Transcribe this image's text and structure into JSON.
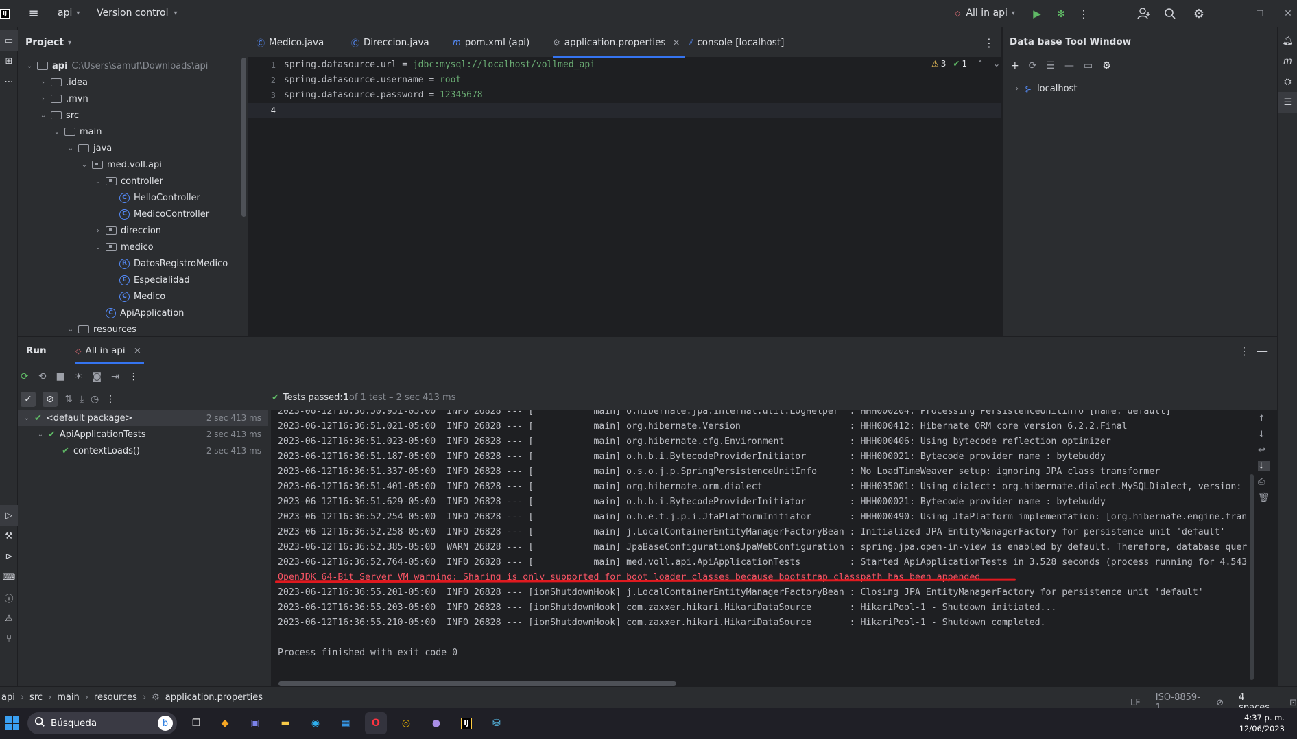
{
  "titlebar": {
    "project_name": "api",
    "vcs": "Version control",
    "run_config": "All in api"
  },
  "project_panel": {
    "title": "Project",
    "tree": [
      {
        "label": "api",
        "path": "C:\\Users\\samuf\\Downloads\\api",
        "kind": "folder",
        "level": 0,
        "expanded": true
      },
      {
        "label": ".idea",
        "kind": "folder",
        "level": 1,
        "expanded": false
      },
      {
        "label": ".mvn",
        "kind": "folder",
        "level": 1,
        "expanded": false
      },
      {
        "label": "src",
        "kind": "folder",
        "level": 1,
        "expanded": true
      },
      {
        "label": "main",
        "kind": "folder",
        "level": 2,
        "expanded": true
      },
      {
        "label": "java",
        "kind": "folder",
        "level": 3,
        "expanded": true
      },
      {
        "label": "med.voll.api",
        "kind": "package",
        "level": 4,
        "expanded": true
      },
      {
        "label": "controller",
        "kind": "package",
        "level": 5,
        "expanded": true
      },
      {
        "label": "HelloController",
        "kind": "class",
        "badge": "C",
        "level": 6
      },
      {
        "label": "MedicoController",
        "kind": "class",
        "badge": "C",
        "level": 6
      },
      {
        "label": "direccion",
        "kind": "package",
        "level": 5,
        "expanded": false
      },
      {
        "label": "medico",
        "kind": "package",
        "level": 5,
        "expanded": true
      },
      {
        "label": "DatosRegistroMedico",
        "kind": "class",
        "badge": "R",
        "level": 6
      },
      {
        "label": "Especialidad",
        "kind": "class",
        "badge": "E",
        "level": 6
      },
      {
        "label": "Medico",
        "kind": "class",
        "badge": "C",
        "level": 6
      },
      {
        "label": "ApiApplication",
        "kind": "class",
        "badge": "C",
        "level": 5
      },
      {
        "label": "resources",
        "kind": "folder",
        "level": 3,
        "expanded": true
      }
    ]
  },
  "editor": {
    "tabs": [
      {
        "label": "Medico.java",
        "icon": "C",
        "active": false
      },
      {
        "label": "Direccion.java",
        "icon": "C",
        "active": false
      },
      {
        "label": "pom.xml (api)",
        "icon": "m",
        "active": false
      },
      {
        "label": "application.properties",
        "icon": "gear",
        "active": true
      },
      {
        "label": "console [localhost]",
        "icon": "db",
        "active": false
      }
    ],
    "close_glyph": "×",
    "lines": [
      {
        "n": "1",
        "key": "spring.datasource.url",
        "eq": " = ",
        "value": "jdbc:mysql://localhost/vollmed_api"
      },
      {
        "n": "2",
        "key": "spring.datasource.username",
        "eq": " = ",
        "value": "root"
      },
      {
        "n": "3",
        "key": "spring.datasource.password",
        "eq": " = ",
        "value": "12345678"
      },
      {
        "n": "4",
        "key": "",
        "eq": "",
        "value": ""
      }
    ],
    "inspections": {
      "warnings": "3",
      "ok": "1"
    }
  },
  "db_panel": {
    "title": "Data base Tool Window",
    "tree": [
      {
        "label": "localhost"
      }
    ]
  },
  "run_panel": {
    "tab_run": "Run",
    "tab_config": "All in api",
    "tests_status_prefix": "Tests passed: ",
    "tests_passed": "1",
    "tests_status_suffix": " of 1 test – 2 sec 413 ms",
    "test_tree": [
      {
        "label": "<default package>",
        "time": "2 sec 413 ms",
        "level": 0
      },
      {
        "label": "ApiApplicationTests",
        "time": "2 sec 413 ms",
        "level": 1
      },
      {
        "label": "contextLoads()",
        "time": "2 sec 413 ms",
        "level": 2
      }
    ],
    "console_lines": [
      {
        "text": "2023-06-12T16:36:50.951-05:00  INFO 26828 --- [           main] o.hibernate.jpa.internal.util.LogHelper  : HHH000204: Processing PersistenceUnitInfo [name: default]",
        "warn": false
      },
      {
        "text": "2023-06-12T16:36:51.021-05:00  INFO 26828 --- [           main] org.hibernate.Version                    : HHH000412: Hibernate ORM core version 6.2.2.Final",
        "warn": false
      },
      {
        "text": "2023-06-12T16:36:51.023-05:00  INFO 26828 --- [           main] org.hibernate.cfg.Environment            : HHH000406: Using bytecode reflection optimizer",
        "warn": false
      },
      {
        "text": "2023-06-12T16:36:51.187-05:00  INFO 26828 --- [           main] o.h.b.i.BytecodeProviderInitiator        : HHH000021: Bytecode provider name : bytebuddy",
        "warn": false
      },
      {
        "text": "2023-06-12T16:36:51.337-05:00  INFO 26828 --- [           main] o.s.o.j.p.SpringPersistenceUnitInfo      : No LoadTimeWeaver setup: ignoring JPA class transformer",
        "warn": false
      },
      {
        "text": "2023-06-12T16:36:51.401-05:00  INFO 26828 --- [           main] org.hibernate.orm.dialect                : HHH035001: Using dialect: org.hibernate.dialect.MySQLDialect, version:",
        "warn": false
      },
      {
        "text": "2023-06-12T16:36:51.629-05:00  INFO 26828 --- [           main] o.h.b.i.BytecodeProviderInitiator        : HHH000021: Bytecode provider name : bytebuddy",
        "warn": false
      },
      {
        "text": "2023-06-12T16:36:52.254-05:00  INFO 26828 --- [           main] o.h.e.t.j.p.i.JtaPlatformInitiator       : HHH000490: Using JtaPlatform implementation: [org.hibernate.engine.tran",
        "warn": false
      },
      {
        "text": "2023-06-12T16:36:52.258-05:00  INFO 26828 --- [           main] j.LocalContainerEntityManagerFactoryBean : Initialized JPA EntityManagerFactory for persistence unit 'default'",
        "warn": false
      },
      {
        "text": "2023-06-12T16:36:52.385-05:00  WARN 26828 --- [           main] JpaBaseConfiguration$JpaWebConfiguration : spring.jpa.open-in-view is enabled by default. Therefore, database quer",
        "warn": false
      },
      {
        "text": "2023-06-12T16:36:52.764-05:00  INFO 26828 --- [           main] med.voll.api.ApiApplicationTests         : Started ApiApplicationTests in 3.528 seconds (process running for 4.543",
        "warn": false
      },
      {
        "text": "OpenJDK 64-Bit Server VM warning: Sharing is only supported for boot loader classes because bootstrap classpath has been appended",
        "warn": true
      },
      {
        "text": "2023-06-12T16:36:55.201-05:00  INFO 26828 --- [ionShutdownHook] j.LocalContainerEntityManagerFactoryBean : Closing JPA EntityManagerFactory for persistence unit 'default'",
        "warn": false
      },
      {
        "text": "2023-06-12T16:36:55.203-05:00  INFO 26828 --- [ionShutdownHook] com.zaxxer.hikari.HikariDataSource       : HikariPool-1 - Shutdown initiated...",
        "warn": false
      },
      {
        "text": "2023-06-12T16:36:55.210-05:00  INFO 26828 --- [ionShutdownHook] com.zaxxer.hikari.HikariDataSource       : HikariPool-1 - Shutdown completed.",
        "warn": false
      },
      {
        "text": "",
        "warn": false
      },
      {
        "text": "Process finished with exit code 0",
        "warn": false
      }
    ]
  },
  "statusbar": {
    "breadcrumb": [
      "api",
      "src",
      "main",
      "resources",
      "application.properties"
    ],
    "separator": "›",
    "line_sep": "LF",
    "encoding": "ISO-8859-1",
    "indent": "4 spaces"
  },
  "taskbar": {
    "search_placeholder": "Búsqueda",
    "time": "4:37 p. m.",
    "date": "12/06/2023"
  },
  "colors": {
    "accent": "#3574f0",
    "success": "#5fb865",
    "error": "#f75464",
    "annotation_underline": "#e0191f"
  }
}
